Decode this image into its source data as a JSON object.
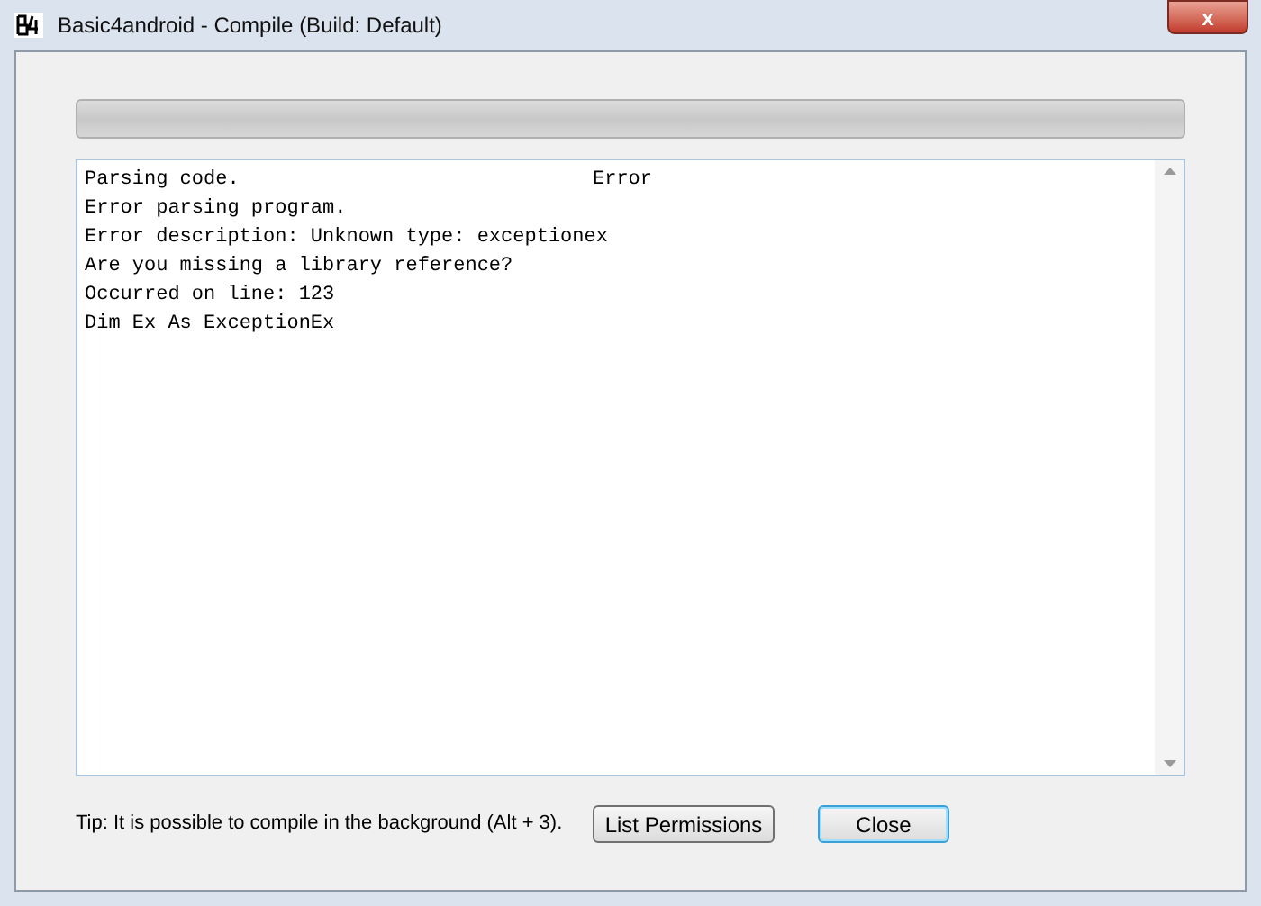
{
  "window": {
    "title": "Basic4android - Compile (Build: Default)",
    "close_label": "x"
  },
  "progress": {
    "level": 0
  },
  "log": {
    "first_line": {
      "text": "Parsing code.",
      "status": "Error"
    },
    "lines": [
      "Error parsing program.",
      "Error description: Unknown type: exceptionex",
      "Are you missing a library reference?",
      "Occurred on line: 123",
      "Dim Ex As ExceptionEx"
    ]
  },
  "tip": "Tip: It is possible to compile in the background (Alt + 3).",
  "buttons": [
    {
      "label": "List Permissions",
      "selected": false
    },
    {
      "label": "Close",
      "selected": true
    }
  ]
}
